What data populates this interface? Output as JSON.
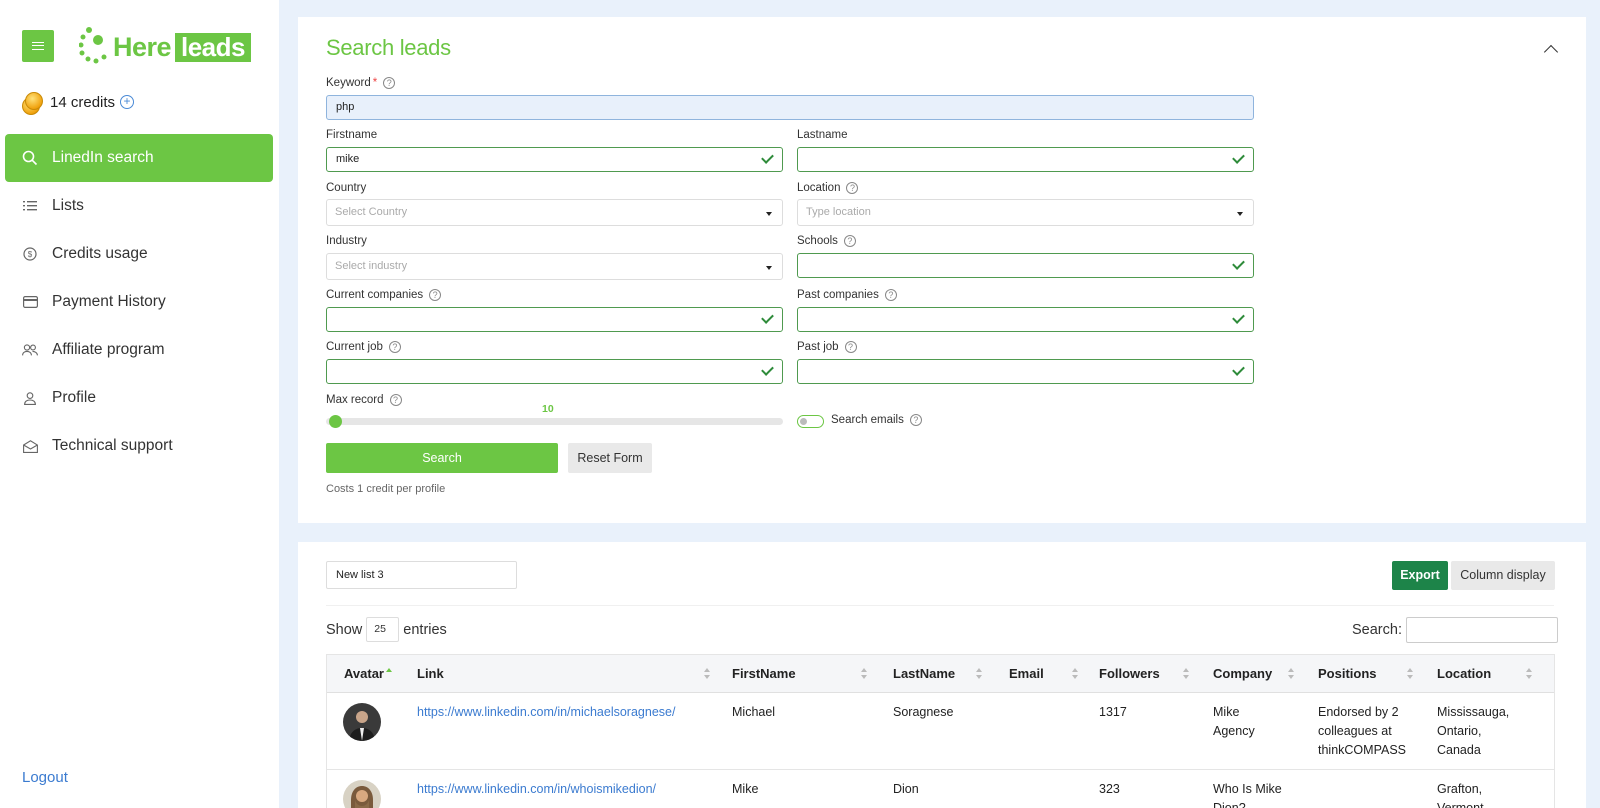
{
  "sidebar": {
    "brand": {
      "part1": "Here",
      "part2": "leads"
    },
    "credits": "14 credits",
    "items": [
      {
        "label": "LinedIn search",
        "icon": "search-icon",
        "active": true
      },
      {
        "label": "Lists",
        "icon": "list-icon"
      },
      {
        "label": "Credits usage",
        "icon": "dollar-icon"
      },
      {
        "label": "Payment History",
        "icon": "credit-card-icon"
      },
      {
        "label": "Affiliate program",
        "icon": "users-icon"
      },
      {
        "label": "Profile",
        "icon": "user-icon"
      },
      {
        "label": "Technical support",
        "icon": "mail-icon"
      }
    ],
    "logout": "Logout"
  },
  "form": {
    "title": "Search leads",
    "keyword": {
      "label": "Keyword",
      "required": "*",
      "value": "php"
    },
    "firstname": {
      "label": "Firstname",
      "value": "mike"
    },
    "lastname": {
      "label": "Lastname",
      "value": ""
    },
    "country": {
      "label": "Country",
      "placeholder": "Select Country"
    },
    "location": {
      "label": "Location",
      "placeholder": "Type location"
    },
    "industry": {
      "label": "Industry",
      "placeholder": "Select industry"
    },
    "schools": {
      "label": "Schools",
      "value": ""
    },
    "current_companies": {
      "label": "Current companies",
      "value": ""
    },
    "past_companies": {
      "label": "Past companies",
      "value": ""
    },
    "current_job": {
      "label": "Current job",
      "value": ""
    },
    "past_job": {
      "label": "Past job",
      "value": ""
    },
    "max_record": {
      "label": "Max record",
      "value": "10"
    },
    "search_emails": {
      "label": "Search emails",
      "enabled": false
    },
    "search_button": "Search",
    "reset_button": "Reset Form",
    "cost_note": "Costs 1 credit per profile"
  },
  "results": {
    "list_name": "New list 3",
    "export_button": "Export",
    "column_display_button": "Column display",
    "show_label": "Show",
    "entries_value": "25",
    "entries_label": "entries",
    "search_label": "Search:",
    "columns": [
      "Avatar",
      "Link",
      "FirstName",
      "LastName",
      "Email",
      "Followers",
      "Company",
      "Positions",
      "Location"
    ],
    "rows": [
      {
        "link": "https://www.linkedin.com/in/michaelsoragnese/",
        "firstname": "Michael",
        "lastname": "Soragnese",
        "email": "",
        "followers": "1317",
        "company": [
          "Mike",
          "Agency"
        ],
        "positions": [
          "Endorsed by 2",
          "colleagues at",
          "thinkCOMPASS"
        ],
        "location": [
          "Mississauga,",
          "Ontario,",
          "Canada"
        ]
      },
      {
        "link": "https://www.linkedin.com/in/whoismikedion/",
        "firstname": "Mike",
        "lastname": "Dion",
        "email": "",
        "followers": "323",
        "company": [
          "Who Is Mike",
          "Dion?"
        ],
        "positions": [],
        "location": [
          "Grafton,",
          "Vermont"
        ]
      }
    ]
  },
  "colors": {
    "accent": "#6cc644",
    "export": "#1d8449",
    "link": "#3b7bd0",
    "background": "#e9f1fb"
  }
}
